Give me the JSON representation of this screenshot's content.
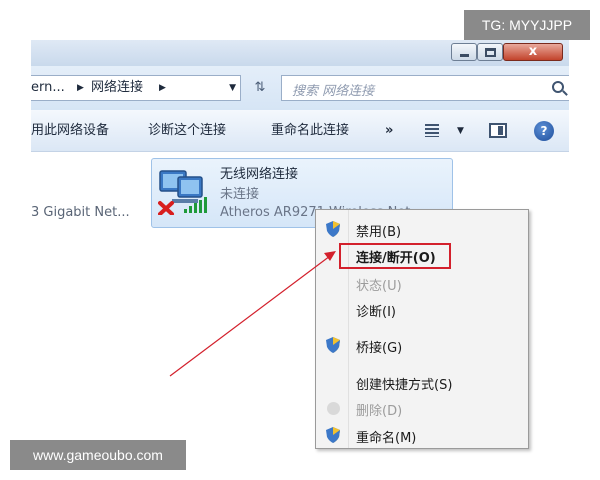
{
  "window": {
    "close_label": "x"
  },
  "address_bar": {
    "path": [
      "ern...",
      "网络连接"
    ],
    "separator_icon": "chevron-right-icon",
    "dropdown_icon": "triangle-down-icon",
    "refresh_icon": "refresh-icon",
    "search_placeholder": "搜索 网络连接",
    "search_icon": "magnifier-icon"
  },
  "toolbar": {
    "items": [
      "用此网络设备",
      "诊断这个连接",
      "重命名此连接"
    ],
    "more_label": "»",
    "view_icon": "view-options-icon",
    "pane_icon": "preview-pane-icon",
    "help_label": "?"
  },
  "connections": {
    "ethernet_label": "3 Gigabit Net...",
    "wireless": {
      "name": "无线网络连接",
      "status": "未连接",
      "adapter": "Atheros AR9271 Wireless Net",
      "icon": "wireless-network-disconnected-icon"
    }
  },
  "context_menu": {
    "items": [
      {
        "label": "禁用(B)",
        "enabled": true,
        "icon": "uac-shield-icon"
      },
      {
        "label": "连接/断开(O)",
        "enabled": true,
        "highlighted": true
      },
      {
        "label": "状态(U)",
        "enabled": false
      },
      {
        "label": "诊断(I)",
        "enabled": true
      },
      {
        "label": "桥接(G)",
        "enabled": true,
        "icon": "uac-shield-icon"
      },
      {
        "label": "创建快捷方式(S)",
        "enabled": true
      },
      {
        "label": "删除(D)",
        "enabled": false,
        "icon": "disabled-shield-icon"
      },
      {
        "label": "重命名(M)",
        "enabled": true,
        "icon": "uac-shield-icon"
      }
    ],
    "highlight_color": "#d3202c"
  },
  "watermarks": {
    "top_right": "TG: MYYJJPP",
    "bottom_left": "www.gameoubo.com"
  }
}
